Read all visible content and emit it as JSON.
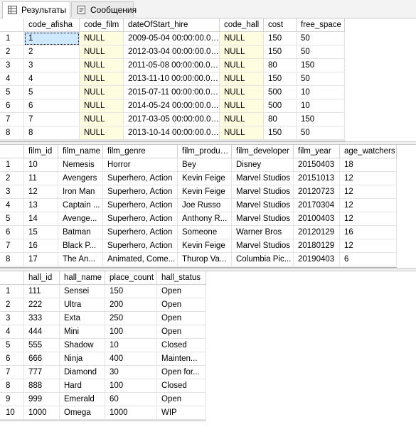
{
  "tabs": [
    {
      "label": "Результаты",
      "icon": "grid-icon"
    },
    {
      "label": "Сообщения",
      "icon": "messages-icon"
    }
  ],
  "afisha": {
    "columns": [
      "code_afisha",
      "code_film",
      "dateOfStart_hire",
      "code_hall",
      "cost",
      "free_space"
    ],
    "rows": [
      [
        "1",
        "1",
        "NULL",
        "2009-05-04 00:00:00.000",
        "NULL",
        "150",
        "50"
      ],
      [
        "2",
        "2",
        "NULL",
        "2012-03-04 00:00:00.000",
        "NULL",
        "150",
        "50"
      ],
      [
        "3",
        "3",
        "NULL",
        "2011-05-08 00:00:00.000",
        "NULL",
        "80",
        "150"
      ],
      [
        "4",
        "4",
        "NULL",
        "2013-11-10 00:00:00.000",
        "NULL",
        "150",
        "50"
      ],
      [
        "5",
        "5",
        "NULL",
        "2015-07-11 00:00:00.000",
        "NULL",
        "500",
        "10"
      ],
      [
        "6",
        "6",
        "NULL",
        "2014-05-24 00:00:00.000",
        "NULL",
        "500",
        "10"
      ],
      [
        "7",
        "7",
        "NULL",
        "2017-03-05 00:00:00.000",
        "NULL",
        "80",
        "150"
      ],
      [
        "8",
        "8",
        "NULL",
        "2013-10-14 00:00:00.000",
        "NULL",
        "150",
        "50"
      ]
    ]
  },
  "films": {
    "columns": [
      "film_id",
      "film_name",
      "film_genre",
      "film_producer",
      "film_developer",
      "film_year",
      "age_watchers"
    ],
    "rows": [
      [
        "1",
        "10",
        "Nemesis",
        "Horror",
        "Bey",
        "Disney",
        "20150403",
        "18"
      ],
      [
        "2",
        "11",
        "Avengers",
        "Superhero, Action",
        "Kevin Feige",
        "Marvel Studios",
        "20151013",
        "12"
      ],
      [
        "3",
        "12",
        "Iron Man",
        "Superhero, Action",
        "Kevin Feige",
        "Marvel Studios",
        "20120723",
        "12"
      ],
      [
        "4",
        "13",
        "Captain ...",
        "Superhero, Action",
        "Joe Russo",
        "Marvel Studios",
        "20170304",
        "12"
      ],
      [
        "5",
        "14",
        "Avenge...",
        "Superhero, Action",
        "Anthony R...",
        "Marvel Studios",
        "20100403",
        "12"
      ],
      [
        "6",
        "15",
        "Batman",
        "Superhero, Action",
        "Someone",
        "Warner Bros",
        "20120129",
        "16"
      ],
      [
        "7",
        "16",
        "Black P...",
        "Superhero, Action",
        "Kevin Feige",
        "Marvel Studios",
        "20180129",
        "12"
      ],
      [
        "8",
        "17",
        "The An...",
        "Animated, Come...",
        "Thurop Va...",
        "Columbia Pic...",
        "20190403",
        "6"
      ]
    ]
  },
  "halls": {
    "columns": [
      "hall_id",
      "hall_name",
      "place_count",
      "hall_status"
    ],
    "rows": [
      [
        "1",
        "111",
        "Sensei",
        "150",
        "Open"
      ],
      [
        "2",
        "222",
        "Ultra",
        "200",
        "Open"
      ],
      [
        "3",
        "333",
        "Exta",
        "250",
        "Open"
      ],
      [
        "4",
        "444",
        "Mini",
        "100",
        "Open"
      ],
      [
        "5",
        "555",
        "Shadow",
        "10",
        "Closed"
      ],
      [
        "6",
        "666",
        "Ninja",
        "400",
        "Mainten..."
      ],
      [
        "7",
        "777",
        "Diamond",
        "30",
        "Open for..."
      ],
      [
        "8",
        "888",
        "Hard",
        "100",
        "Closed"
      ],
      [
        "9",
        "999",
        "Emerald",
        "60",
        "Open"
      ],
      [
        "10",
        "1000",
        "Omega",
        "1000",
        "WIP"
      ]
    ]
  }
}
